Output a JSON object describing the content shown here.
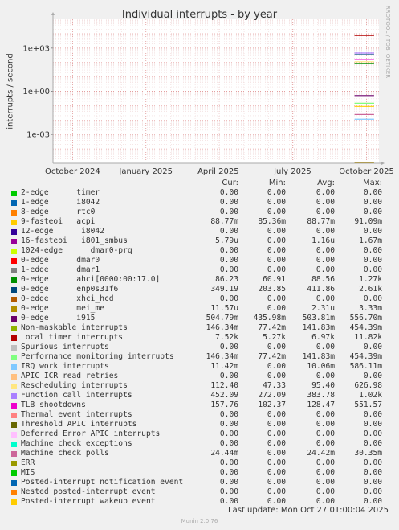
{
  "chart_data": {
    "type": "line",
    "title": "Individual interrupts - by year",
    "ylabel": "interrupts / second",
    "xlabel": "",
    "y_scale": "log",
    "ylim": [
      1e-05,
      100000
    ],
    "y_ticks": [
      "1e+03",
      "1e+00",
      "1e-03"
    ],
    "x_ticks": [
      "October 2024",
      "January 2025",
      "April 2025",
      "July 2025",
      "October 2025"
    ],
    "side_label": "RRDTOOL / TOBI OETIKER",
    "grid": true,
    "columns": [
      "Cur:",
      "Min:",
      "Avg:",
      "Max:"
    ],
    "series": [
      {
        "name": "2-edge      timer",
        "color": "#00cc00",
        "values": [
          "0.00",
          "0.00",
          "0.00",
          "0.00"
        ]
      },
      {
        "name": "1-edge      i8042",
        "color": "#0066b3",
        "values": [
          "0.00",
          "0.00",
          "0.00",
          "0.00"
        ]
      },
      {
        "name": "8-edge      rtc0",
        "color": "#ff8000",
        "values": [
          "0.00",
          "0.00",
          "0.00",
          "0.00"
        ]
      },
      {
        "name": "9-fasteoi   acpi",
        "color": "#ffcc00",
        "values": [
          "88.77m",
          "85.36m",
          "88.77m",
          "91.09m"
        ]
      },
      {
        "name": "12-edge      i8042",
        "color": "#330099",
        "values": [
          "0.00",
          "0.00",
          "0.00",
          "0.00"
        ]
      },
      {
        "name": "16-fasteoi   i801_smbus",
        "color": "#990099",
        "values": [
          "5.79u",
          "0.00",
          "1.16u",
          "1.67m"
        ]
      },
      {
        "name": "1024-edge      dmar0-prq",
        "color": "#ccff00",
        "values": [
          "0.00",
          "0.00",
          "0.00",
          "0.00"
        ]
      },
      {
        "name": "0-edge      dmar0",
        "color": "#ff0000",
        "values": [
          "0.00",
          "0.00",
          "0.00",
          "0.00"
        ]
      },
      {
        "name": "1-edge      dmar1",
        "color": "#808080",
        "values": [
          "0.00",
          "0.00",
          "0.00",
          "0.00"
        ]
      },
      {
        "name": "0-edge      ahci[0000:00:17.0]",
        "color": "#008f00",
        "values": [
          "86.23",
          "60.91",
          "88.56",
          "1.27k"
        ]
      },
      {
        "name": "0-edge      enp0s31f6",
        "color": "#00487d",
        "values": [
          "349.19",
          "203.85",
          "411.86",
          "2.61k"
        ]
      },
      {
        "name": "0-edge      xhci_hcd",
        "color": "#b35a00",
        "values": [
          "0.00",
          "0.00",
          "0.00",
          "0.00"
        ]
      },
      {
        "name": "0-edge      mei_me",
        "color": "#b38f00",
        "values": [
          "11.57u",
          "0.00",
          "2.31u",
          "3.33m"
        ]
      },
      {
        "name": "0-edge      i915",
        "color": "#6b006b",
        "values": [
          "504.79m",
          "435.98m",
          "503.81m",
          "556.70m"
        ]
      },
      {
        "name": "Non-maskable interrupts",
        "color": "#8fb300",
        "values": [
          "146.34m",
          "77.42m",
          "141.83m",
          "454.39m"
        ]
      },
      {
        "name": "Local timer interrupts",
        "color": "#b30000",
        "values": [
          "7.52k",
          "5.27k",
          "6.97k",
          "11.82k"
        ]
      },
      {
        "name": "Spurious interrupts",
        "color": "#bebebe",
        "values": [
          "0.00",
          "0.00",
          "0.00",
          "0.00"
        ]
      },
      {
        "name": "Performance monitoring interrupts",
        "color": "#80ff80",
        "values": [
          "146.34m",
          "77.42m",
          "141.83m",
          "454.39m"
        ]
      },
      {
        "name": "IRQ work interrupts",
        "color": "#80c9ff",
        "values": [
          "11.42m",
          "0.00",
          "10.06m",
          "586.11m"
        ]
      },
      {
        "name": "APIC ICR read retries",
        "color": "#ffc080",
        "values": [
          "0.00",
          "0.00",
          "0.00",
          "0.00"
        ]
      },
      {
        "name": "Rescheduling interrupts",
        "color": "#ffe680",
        "values": [
          "112.40",
          "47.33",
          "95.40",
          "626.98"
        ]
      },
      {
        "name": "Function call interrupts",
        "color": "#aa80ff",
        "values": [
          "452.09",
          "272.09",
          "383.78",
          "1.02k"
        ]
      },
      {
        "name": "TLB shootdowns",
        "color": "#ee00cc",
        "values": [
          "157.76",
          "102.37",
          "128.47",
          "551.57"
        ]
      },
      {
        "name": "Thermal event interrupts",
        "color": "#ff8080",
        "values": [
          "0.00",
          "0.00",
          "0.00",
          "0.00"
        ]
      },
      {
        "name": "Threshold APIC interrupts",
        "color": "#666600",
        "values": [
          "0.00",
          "0.00",
          "0.00",
          "0.00"
        ]
      },
      {
        "name": "Deferred Error APIC interrupts",
        "color": "#ffbfff",
        "values": [
          "0.00",
          "0.00",
          "0.00",
          "0.00"
        ]
      },
      {
        "name": "Machine check exceptions",
        "color": "#00ffcc",
        "values": [
          "0.00",
          "0.00",
          "0.00",
          "0.00"
        ]
      },
      {
        "name": "Machine check polls",
        "color": "#cc6699",
        "values": [
          "24.44m",
          "0.00",
          "24.42m",
          "30.35m"
        ]
      },
      {
        "name": "ERR",
        "color": "#999900",
        "values": [
          "0.00",
          "0.00",
          "0.00",
          "0.00"
        ]
      },
      {
        "name": "MIS",
        "color": "#00cc00",
        "values": [
          "0.00",
          "0.00",
          "0.00",
          "0.00"
        ]
      },
      {
        "name": "Posted-interrupt notification event",
        "color": "#0066b3",
        "values": [
          "0.00",
          "0.00",
          "0.00",
          "0.00"
        ]
      },
      {
        "name": "Nested posted-interrupt event",
        "color": "#ff8000",
        "values": [
          "0.00",
          "0.00",
          "0.00",
          "0.00"
        ]
      },
      {
        "name": "Posted-interrupt wakeup event",
        "color": "#ffcc00",
        "values": [
          "0.00",
          "0.00",
          "0.00",
          "0.00"
        ]
      }
    ]
  },
  "footer": {
    "last_update": "Last update: Mon Oct 27 01:00:04 2025",
    "version": "Munin 2.0.76"
  }
}
